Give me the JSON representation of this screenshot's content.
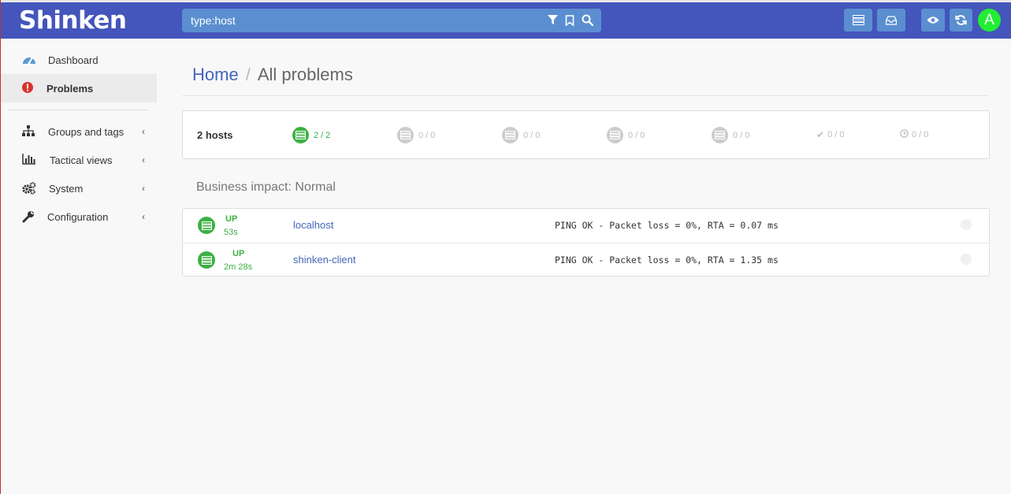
{
  "navbar": {
    "brand": "Shinken",
    "search_value": "type:host",
    "search_icons": [
      "filter-icon",
      "bookmark-icon",
      "search-icon"
    ],
    "buttons": [
      "server-list-icon",
      "inbox-icon",
      "eye-icon",
      "refresh-icon"
    ],
    "avatar_letter": "A",
    "colors": {
      "bar": "#4455bb",
      "field": "#5b8ed0",
      "avatar": "#22ee33"
    }
  },
  "sidebar": {
    "items": [
      {
        "label": "Dashboard",
        "icon": "dashboard-icon",
        "active": false
      },
      {
        "label": "Problems",
        "icon": "exclamation-icon",
        "active": true
      }
    ],
    "groups": [
      {
        "label": "Groups and tags",
        "icon": "sitemap-icon"
      },
      {
        "label": "Tactical views",
        "icon": "bar-chart-icon"
      },
      {
        "label": "System",
        "icon": "cogs-icon"
      },
      {
        "label": "Configuration",
        "icon": "wrench-icon"
      }
    ]
  },
  "breadcrumb": {
    "home": "Home",
    "separator": "/",
    "current": "All problems"
  },
  "summary": {
    "hosts_label": "2 hosts",
    "stats": [
      {
        "value": "2 / 2",
        "color": "#3cb043"
      },
      {
        "value": "0 / 0",
        "color": "#cccccc"
      },
      {
        "value": "0 / 0",
        "color": "#cccccc"
      },
      {
        "value": "0 / 0",
        "color": "#cccccc"
      },
      {
        "value": "0 / 0",
        "color": "#cccccc"
      },
      {
        "value": "0 / 0",
        "icon": "check-icon"
      },
      {
        "value": "0 / 0",
        "icon": "clock-icon"
      }
    ]
  },
  "impact_heading": "Business impact: Normal",
  "hosts": [
    {
      "state": "UP",
      "duration": "53s",
      "name": "localhost",
      "output": "PING OK - Packet loss = 0%, RTA = 0.07 ms"
    },
    {
      "state": "UP",
      "duration": "2m 28s",
      "name": "shinken-client",
      "output": "PING OK - Packet loss = 0%, RTA = 1.35 ms"
    }
  ]
}
